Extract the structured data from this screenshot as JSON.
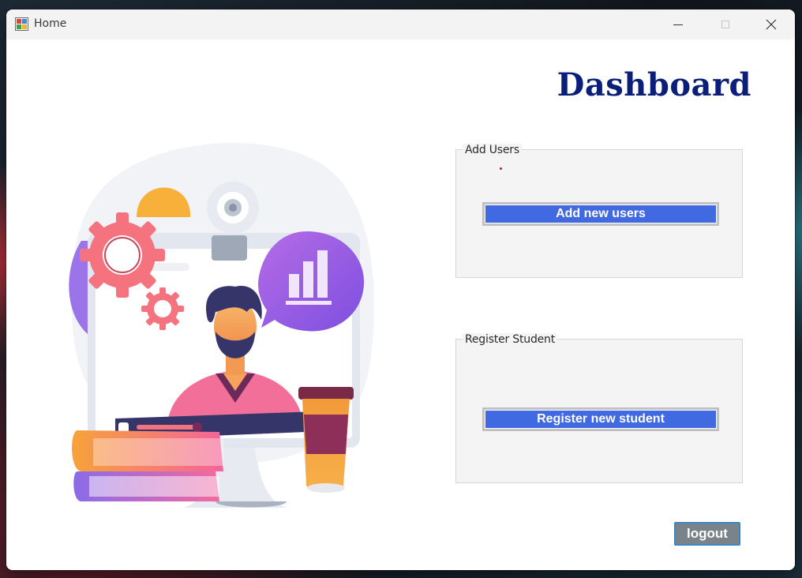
{
  "window": {
    "title": "Home",
    "icon": "windows-form-icon"
  },
  "controls": {
    "minimize_icon": "minimize-icon",
    "maximize_icon": "maximize-icon",
    "close_icon": "close-icon"
  },
  "dashboard": {
    "title": "Dashboard"
  },
  "groups": {
    "add_users": {
      "legend": "Add Users",
      "button_label": "Add new users"
    },
    "register_student": {
      "legend": "Register Student",
      "button_label": "Register new student"
    }
  },
  "logout": {
    "label": "logout"
  },
  "colors": {
    "title": "#0b1f7a",
    "button_blue": "#4169e1",
    "logout_gray": "#7a838a",
    "logout_border": "#3b86c8"
  }
}
